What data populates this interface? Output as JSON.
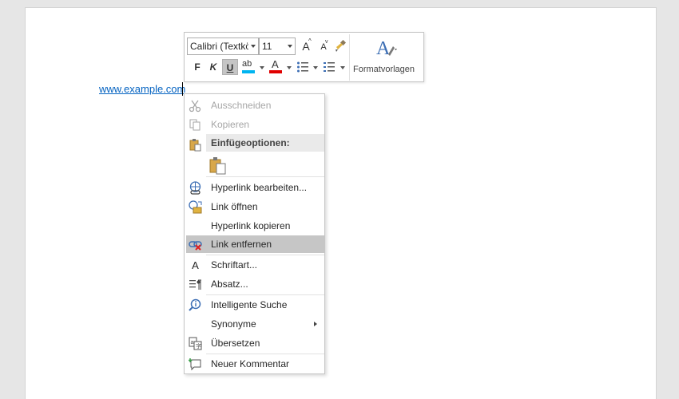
{
  "document": {
    "link_text": "www.example.com"
  },
  "mini_toolbar": {
    "font_name": "Calibri (Textkö",
    "font_size": "11",
    "grow_font": "A",
    "shrink_font": "A",
    "bold": "F",
    "italic": "K",
    "underline": "U",
    "highlight": "ab",
    "font_color": "A",
    "styles_label": "Formatvorlagen"
  },
  "context_menu": {
    "cut": "Ausschneiden",
    "copy": "Kopieren",
    "paste_options": "Einfügeoptionen:",
    "edit_hyperlink": "Hyperlink bearbeiten...",
    "open_link": "Link öffnen",
    "copy_hyperlink": "Hyperlink kopieren",
    "remove_link": "Link entfernen",
    "font": "Schriftart...",
    "paragraph": "Absatz...",
    "smart_lookup": "Intelligente Suche",
    "synonyms": "Synonyme",
    "translate": "Übersetzen",
    "new_comment": "Neuer Kommentar"
  },
  "colors": {
    "link": "#0563c1",
    "highlight_bar": "#00b4f0",
    "font_color_bar": "#e00000",
    "hover": "#c6c6c6"
  }
}
